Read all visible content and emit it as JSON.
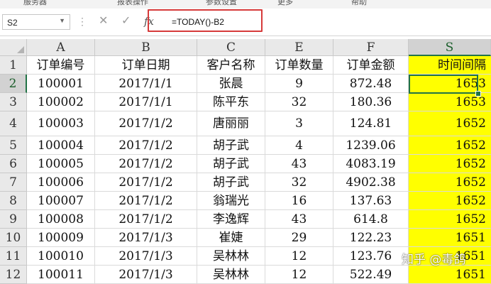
{
  "ribbon": {
    "groups": [
      "服务器",
      "报表操作",
      "参数设置",
      "更多",
      "帮助"
    ]
  },
  "formula_bar": {
    "name_box": "S2",
    "fx": "fx",
    "formula": "=TODAY()-B2"
  },
  "columns": [
    "A",
    "B",
    "C",
    "E",
    "F",
    "S"
  ],
  "selected_column": "S",
  "selected_row": "2",
  "rows": [
    {
      "num": "1",
      "cells": [
        "订单编号",
        "订单日期",
        "客户名称",
        "订单数量",
        "订单金额",
        "时间间隔"
      ]
    },
    {
      "num": "2",
      "cells": [
        "100001",
        "2017/1/1",
        "张晨",
        "9",
        "872.48",
        "1653"
      ]
    },
    {
      "num": "3",
      "cells": [
        "100002",
        "2017/1/1",
        "陈平东",
        "32",
        "180.36",
        "1653"
      ]
    },
    {
      "num": "4",
      "cells": [
        "100003",
        "2017/1/2",
        "唐丽丽",
        "3",
        "124.81",
        "1652"
      ]
    },
    {
      "num": "5",
      "cells": [
        "100004",
        "2017/1/2",
        "胡子武",
        "4",
        "1239.06",
        "1652"
      ]
    },
    {
      "num": "6",
      "cells": [
        "100005",
        "2017/1/2",
        "胡子武",
        "43",
        "4083.19",
        "1652"
      ]
    },
    {
      "num": "7",
      "cells": [
        "100006",
        "2017/1/2",
        "胡子武",
        "32",
        "4902.38",
        "1652"
      ]
    },
    {
      "num": "8",
      "cells": [
        "100007",
        "2017/1/2",
        "翁瑞光",
        "16",
        "137.63",
        "1652"
      ]
    },
    {
      "num": "9",
      "cells": [
        "100008",
        "2017/1/2",
        "李逸辉",
        "43",
        "614.8",
        "1652"
      ]
    },
    {
      "num": "10",
      "cells": [
        "100009",
        "2017/1/3",
        "崔婕",
        "29",
        "122.23",
        "1651"
      ]
    },
    {
      "num": "11",
      "cells": [
        "100010",
        "2017/1/3",
        "吴林林",
        "12",
        "123.76",
        "1651"
      ]
    },
    {
      "num": "12",
      "cells": [
        "100011",
        "2017/1/3",
        "吴林林",
        "12",
        "522.49",
        "1651"
      ]
    }
  ],
  "watermark": "知乎 @毒鸽",
  "colors": {
    "accent": "#217346",
    "highlight_column": "#ffff00",
    "annotation_box": "#d63a3a"
  }
}
